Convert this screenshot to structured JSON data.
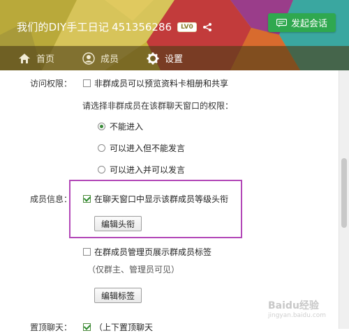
{
  "header": {
    "group_name": "我们的DIY手工日记",
    "group_id": "451356286",
    "level_badge": "LV0",
    "chat_button_label": "发起会话"
  },
  "tabs": [
    {
      "label": "首页",
      "icon": "home-icon"
    },
    {
      "label": "成员",
      "icon": "member-icon"
    },
    {
      "label": "设置",
      "icon": "gear-icon",
      "active": true
    }
  ],
  "settings": {
    "access_label": "访问权限：",
    "access_checkbox": {
      "label": "非群成员可以预览资料卡相册和共享",
      "checked": false
    },
    "non_member_prompt": "请选择非群成员在该群聊天窗口的权限：",
    "radio_options": [
      {
        "label": "不能进入",
        "checked": true
      },
      {
        "label": "可以进入但不能发言",
        "checked": false
      },
      {
        "label": "可以进入并可以发言",
        "checked": false
      }
    ],
    "member_info_label": "成员信息：",
    "show_level_checkbox": {
      "label": "在聊天窗口中显示该群成员等级头衔",
      "checked": true
    },
    "edit_title_button": "编辑头衔",
    "show_tag_checkbox": {
      "label": "在群成员管理页展示群成员标签",
      "checked": false
    },
    "tag_note": "（仅群主、管理员可见）",
    "edit_tag_button": "编辑标签",
    "partial_label": "置顶聊天：",
    "partial_checkbox": {
      "label": "（上下置顶聊天",
      "checked": true
    }
  },
  "watermark": {
    "text": "Baidu经验",
    "sub": "jingyan.baidu.com"
  },
  "colors": {
    "accent_green": "#2fa84f",
    "highlight": "#b247b7"
  }
}
